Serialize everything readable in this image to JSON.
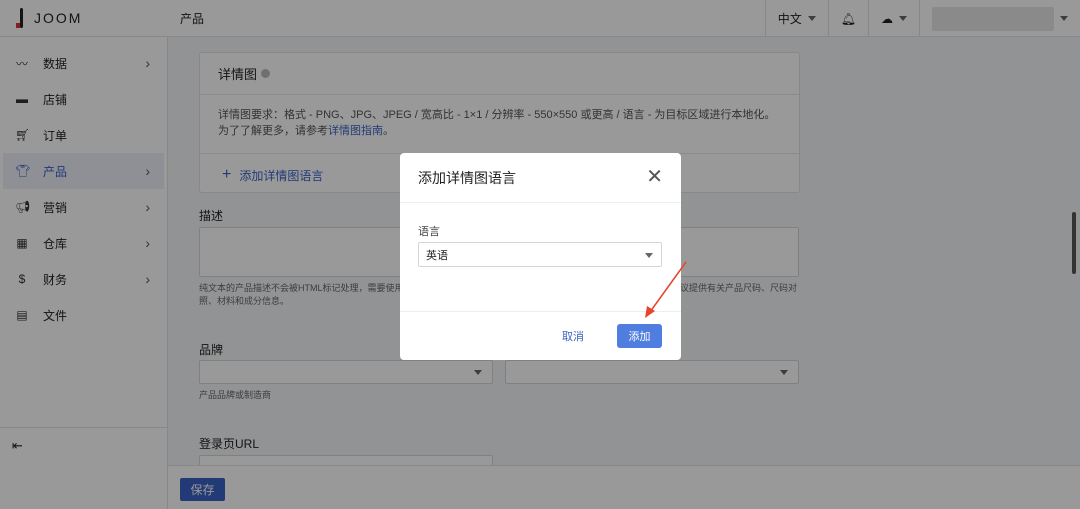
{
  "topbar": {
    "logo": "JOOM",
    "breadcrumb": "产品",
    "language": "中文"
  },
  "sidebar": {
    "items": [
      {
        "label": "数据",
        "icon": "chart-icon",
        "chevron": true
      },
      {
        "label": "店铺",
        "icon": "store-icon",
        "chevron": false
      },
      {
        "label": "订单",
        "icon": "cart-icon",
        "chevron": false
      },
      {
        "label": "产品",
        "icon": "shirt-icon",
        "chevron": true,
        "active": true
      },
      {
        "label": "营销",
        "icon": "megaphone-icon",
        "chevron": true
      },
      {
        "label": "仓库",
        "icon": "boxes-icon",
        "chevron": true
      },
      {
        "label": "财务",
        "icon": "dollar-icon",
        "chevron": true
      },
      {
        "label": "文件",
        "icon": "document-icon",
        "chevron": false
      }
    ]
  },
  "detail_card": {
    "title": "详情图",
    "requirements": "详情图要求：格式 - PNG、JPG、JPEG / 宽高比 - 1×1 / 分辨率 - 550×550 或更高 / 语言 - 为目标区域进行本地化。",
    "more_prefix": "为了了解更多，请参考",
    "more_link": "详情图指南",
    "more_suffix": "。",
    "add_language": "添加详情图语言"
  },
  "description": {
    "label": "描述",
    "hint_left": "纯文本的产品描述不会被HTML标记处理，需要使用",
    "hint_right": "议提供有关产品尺码、尺码对",
    "hint_line2": "照、材料和成分信息。"
  },
  "brand": {
    "label": "品牌",
    "hint": "产品品牌或制造商"
  },
  "landing": {
    "label": "登录页URL"
  },
  "footer": {
    "save": "保存"
  },
  "modal": {
    "title": "添加详情图语言",
    "language_label": "语言",
    "language_value": "英语",
    "cancel": "取消",
    "add": "添加"
  },
  "colors": {
    "accent": "#3a62c4",
    "annotation_arrow": "#e8432d"
  }
}
